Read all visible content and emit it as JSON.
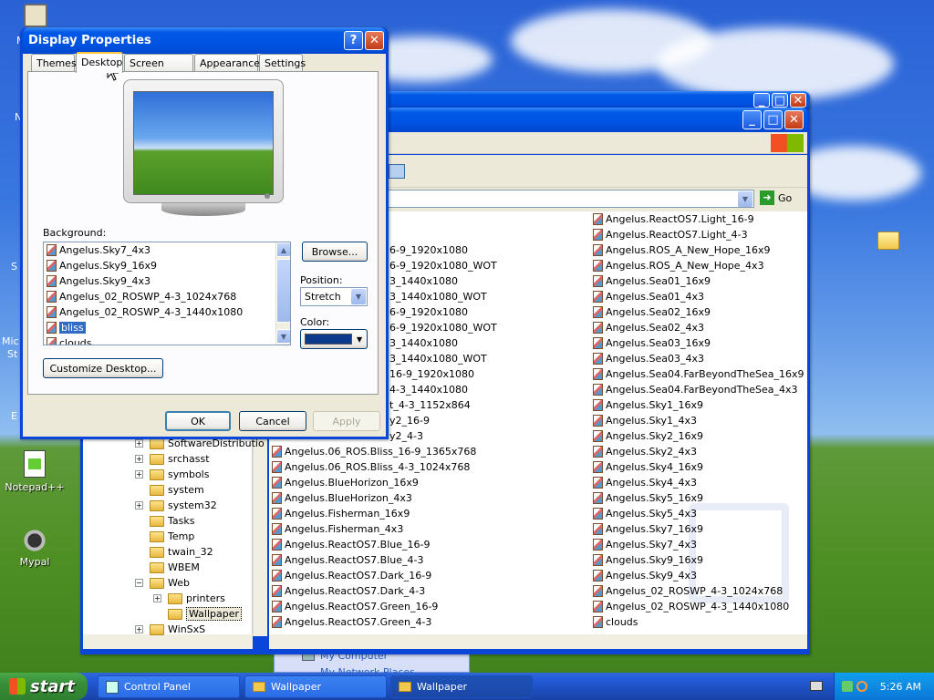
{
  "dialog": {
    "title": "Display Properties",
    "tabs": [
      "Themes",
      "Desktop",
      "Screen Saver",
      "Appearance",
      "Settings"
    ],
    "active_tab": "Desktop",
    "background_label": "Background:",
    "background_items": [
      "Angelus.Sky7_4x3",
      "Angelus.Sky9_16x9",
      "Angelus.Sky9_4x3",
      "Angelus_02_ROSWP_4-3_1024x768",
      "Angelus_02_ROSWP_4-3_1440x1080",
      "bliss",
      "clouds"
    ],
    "selected_background": "bliss",
    "browse_label": "Browse...",
    "position_label": "Position:",
    "position_value": "Stretch",
    "color_label": "Color:",
    "color_value": "#0b3a8c",
    "customize_label": "Customize Desktop...",
    "ok_label": "OK",
    "cancel_label": "Cancel",
    "apply_label": "Apply"
  },
  "explorer": {
    "go_label": "Go",
    "left_column_fragments": [
      "6-9_1920x1080",
      "6-9_1920x1080_WOT",
      "3_1440x1080",
      "3_1440x1080_WOT",
      "6-9_1920x1080",
      "6-9_1920x1080_WOT",
      "3_1440x1080",
      "3_1440x1080_WOT",
      "16-9_1920x1080",
      "4-3_1440x1080",
      "t_4-3_1152x864",
      "y2_16-9",
      "y2_4-3"
    ],
    "left_column_files": [
      "Angelus.06_ROS.Bliss_16-9_1365x768",
      "Angelus.06_ROS.Bliss_4-3_1024x768",
      "Angelus.BlueHorizon_16x9",
      "Angelus.BlueHorizon_4x3",
      "Angelus.Fisherman_16x9",
      "Angelus.Fisherman_4x3",
      "Angelus.ReactOS7.Blue_16-9",
      "Angelus.ReactOS7.Blue_4-3",
      "Angelus.ReactOS7.Dark_16-9",
      "Angelus.ReactOS7.Dark_4-3",
      "Angelus.ReactOS7.Green_16-9",
      "Angelus.ReactOS7.Green_4-3"
    ],
    "right_column_files": [
      "Angelus.ReactOS7.Light_16-9",
      "Angelus.ReactOS7.Light_4-3",
      "Angelus.ROS_A_New_Hope_16x9",
      "Angelus.ROS_A_New_Hope_4x3",
      "Angelus.Sea01_16x9",
      "Angelus.Sea01_4x3",
      "Angelus.Sea02_16x9",
      "Angelus.Sea02_4x3",
      "Angelus.Sea03_16x9",
      "Angelus.Sea03_4x3",
      "Angelus.Sea04.FarBeyondTheSea_16x9",
      "Angelus.Sea04.FarBeyondTheSea_4x3",
      "Angelus.Sky1_16x9",
      "Angelus.Sky1_4x3",
      "Angelus.Sky2_16x9",
      "Angelus.Sky2_4x3",
      "Angelus.Sky4_16x9",
      "Angelus.Sky4_4x3",
      "Angelus.Sky5_16x9",
      "Angelus.Sky5_4x3",
      "Angelus.Sky7_16x9",
      "Angelus.Sky7_4x3",
      "Angelus.Sky9_16x9",
      "Angelus.Sky9_4x3",
      "Angelus_02_ROSWP_4-3_1024x768",
      "Angelus_02_ROSWP_4-3_1440x1080",
      "clouds"
    ],
    "tree": [
      {
        "label": "SoftwareDistributio",
        "expandable": true
      },
      {
        "label": "srchasst",
        "expandable": true
      },
      {
        "label": "symbols",
        "expandable": true
      },
      {
        "label": "system",
        "expandable": false
      },
      {
        "label": "system32",
        "expandable": true
      },
      {
        "label": "Tasks",
        "expandable": false
      },
      {
        "label": "Temp",
        "expandable": false
      },
      {
        "label": "twain_32",
        "expandable": false
      },
      {
        "label": "WBEM",
        "expandable": false
      },
      {
        "label": "Web",
        "expandable": true
      },
      {
        "label": "printers",
        "expandable": true
      },
      {
        "label": "Wallpaper",
        "expandable": false
      },
      {
        "label": "WinSxS",
        "expandable": true
      }
    ]
  },
  "background_window": {
    "links": [
      "My Computer",
      "My Network Places"
    ]
  },
  "desktop_icons": [
    {
      "label": "Notepad++",
      "icon": "notepad-icon"
    },
    {
      "label": "Mypal",
      "icon": "mypal-icon"
    }
  ],
  "desktop_edge_labels": [
    "M",
    "N",
    "S",
    "Mic",
    "St",
    "E"
  ],
  "taskbar": {
    "start_label": "start",
    "items": [
      "Control Panel",
      "Wallpaper",
      "Wallpaper"
    ],
    "clock": "5:26 AM"
  }
}
